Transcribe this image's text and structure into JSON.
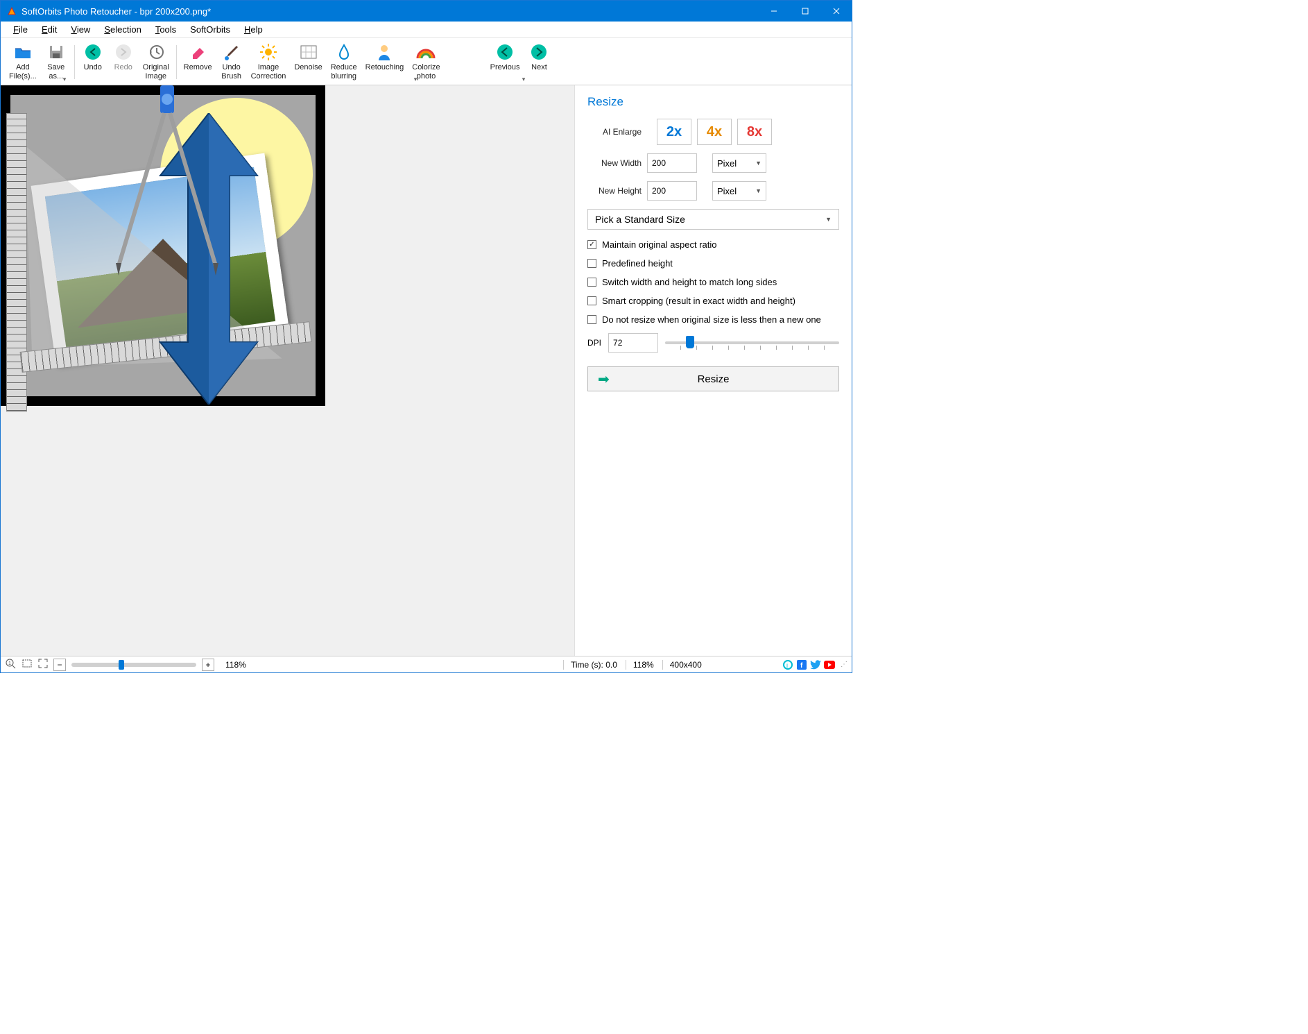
{
  "titlebar": {
    "title": "SoftOrbits Photo Retoucher - bpr 200x200.png*"
  },
  "menu": {
    "file": "File",
    "edit": "Edit",
    "view": "View",
    "selection": "Selection",
    "tools": "Tools",
    "softorbits": "SoftOrbits",
    "help": "Help"
  },
  "toolbar": {
    "addfiles": "Add\nFile(s)...",
    "saveas": "Save\nas...",
    "undo": "Undo",
    "redo": "Redo",
    "original": "Original\nImage",
    "remove": "Remove",
    "undobrush": "Undo\nBrush",
    "imagecorrection": "Image\nCorrection",
    "denoise": "Denoise",
    "reduceblur": "Reduce\nblurring",
    "retouching": "Retouching",
    "colorize": "Colorize\nphoto",
    "previous": "Previous",
    "next": "Next"
  },
  "resize": {
    "heading": "Resize",
    "aienlarge": "AI Enlarge",
    "e2": "2x",
    "e4": "4x",
    "e8": "8x",
    "newwidth_label": "New Width",
    "newwidth_value": "200",
    "newheight_label": "New Height",
    "newheight_value": "200",
    "unit": "Pixel",
    "standardsize": "Pick a Standard Size",
    "maintain": "Maintain original aspect ratio",
    "predefined": "Predefined height",
    "switch": "Switch width and height to match long sides",
    "smartcrop": "Smart cropping (result in exact width and height)",
    "noresize": "Do not resize when original size is less then a new one",
    "dpi_label": "DPI",
    "dpi_value": "72",
    "resize_btn": "Resize"
  },
  "status": {
    "zoom_percent": "118%",
    "time": "Time (s): 0.0",
    "zoom_right": "118%",
    "dims": "400x400"
  }
}
